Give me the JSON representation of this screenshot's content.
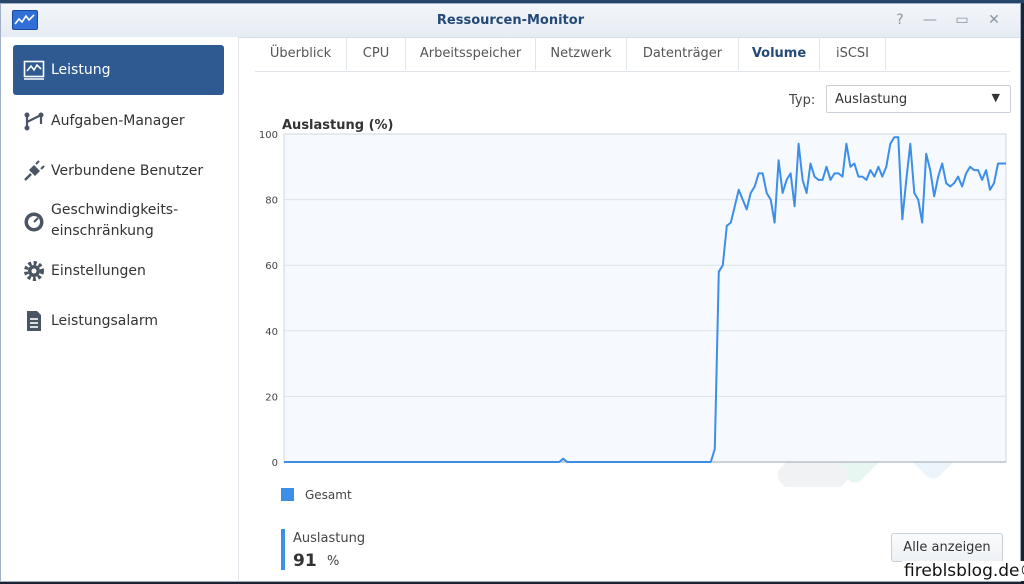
{
  "window": {
    "title": "Ressourcen-Monitor",
    "buttons": {
      "help": "?",
      "minimize": "—",
      "maximize": "▭",
      "close": "✕"
    }
  },
  "sidebar": {
    "items": [
      {
        "label": "Leistung",
        "icon": "performance-chart-icon",
        "active": true
      },
      {
        "label": "Aufgaben-Manager",
        "icon": "task-manager-icon",
        "active": false
      },
      {
        "label": "Verbundene Benutzer",
        "icon": "plug-icon",
        "active": false
      },
      {
        "label": "Geschwindigkeits-",
        "label2": "einschränkung",
        "icon": "speed-limit-icon",
        "active": false
      },
      {
        "label": "Einstellungen",
        "icon": "gear-icon",
        "active": false
      },
      {
        "label": "Leistungsalarm",
        "icon": "alarm-list-icon",
        "active": false
      }
    ]
  },
  "tabs": [
    {
      "label": "Überblick",
      "active": false
    },
    {
      "label": "CPU",
      "active": false
    },
    {
      "label": "Arbeitsspeicher",
      "active": false
    },
    {
      "label": "Netzwerk",
      "active": false
    },
    {
      "label": "Datenträger",
      "active": false
    },
    {
      "label": "Volume",
      "active": true
    },
    {
      "label": "iSCSI",
      "active": false
    }
  ],
  "type_selector": {
    "label": "Typ:",
    "value": "Auslastung"
  },
  "chart_data": {
    "type": "line",
    "title": "Auslastung (%)",
    "xlabel": "",
    "ylabel": "",
    "ylim": [
      0,
      100
    ],
    "yticks": [
      0,
      20,
      40,
      60,
      80,
      100
    ],
    "grid": true,
    "series": [
      {
        "name": "Gesamt",
        "color": "#3d8ee8",
        "values": [
          0,
          0,
          0,
          0,
          0,
          0,
          0,
          0,
          0,
          0,
          0,
          0,
          0,
          0,
          0,
          0,
          0,
          0,
          0,
          0,
          0,
          0,
          0,
          0,
          0,
          0,
          0,
          0,
          0,
          0,
          0,
          0,
          0,
          0,
          0,
          0,
          0,
          0,
          0,
          0,
          0,
          0,
          0,
          0,
          0,
          0,
          0,
          0,
          0,
          0,
          0,
          0,
          0,
          0,
          0,
          0,
          0,
          0,
          0,
          0,
          0,
          0,
          0,
          0,
          0,
          0,
          0,
          0,
          0,
          0,
          1,
          0,
          0,
          0,
          0,
          0,
          0,
          0,
          0,
          0,
          0,
          0,
          0,
          0,
          0,
          0,
          0,
          0,
          0,
          0,
          0,
          0,
          0,
          0,
          0,
          0,
          0,
          0,
          0,
          0,
          0,
          0,
          0,
          0,
          0,
          0,
          0,
          0,
          4,
          58,
          60,
          72,
          73,
          78,
          83,
          80,
          77,
          82,
          84,
          88,
          88,
          82,
          80,
          73,
          92,
          82,
          86,
          88,
          78,
          97,
          86,
          82,
          91,
          87,
          86,
          86,
          90,
          86,
          88,
          88,
          87,
          97,
          90,
          91,
          87,
          87,
          86,
          89,
          87,
          90,
          87,
          90,
          97,
          99,
          99,
          74,
          86,
          97,
          82,
          80,
          73,
          94,
          89,
          81,
          87,
          91,
          85,
          84,
          85,
          87,
          84,
          88,
          90,
          89,
          89,
          86,
          89,
          83,
          85,
          91,
          91,
          91
        ]
      }
    ]
  },
  "legend": {
    "label": "Gesamt"
  },
  "kpi": {
    "label": "Auslastung",
    "value": "91",
    "unit": "%"
  },
  "show_all_button": "Alle anzeigen",
  "watermark": "fireblsblog.de©"
}
